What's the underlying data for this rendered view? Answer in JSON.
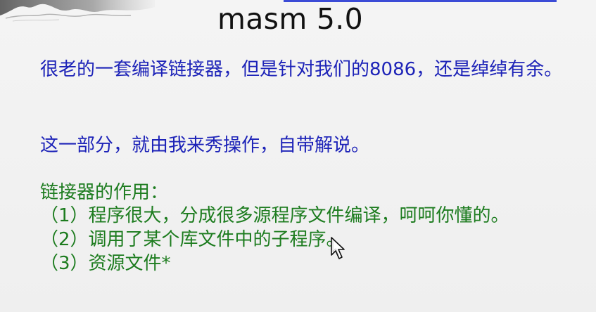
{
  "slide": {
    "title": "masm 5.0",
    "paragraph_1": "很老的一套编译链接器，但是针对我们的8086，还是绰绰有余。",
    "paragraph_2": "这一部分，就由我来秀操作，自带解说。",
    "section_heading": "链接器的作用：",
    "list_items": [
      "（1）程序很大，分成很多源程序文件编译，呵呵你懂的。",
      "（2）调用了某个库文件中的子程序。",
      "（3）资源文件*"
    ]
  },
  "colors": {
    "title": "#111111",
    "blue_text": "#1d23b8",
    "green_text": "#1d7c1f",
    "accent_line": "#3b4bd6",
    "background": "#f1f1f1"
  },
  "icons": {
    "decoration": "ink-landscape-decoration",
    "cursor": "mouse-pointer-icon"
  }
}
